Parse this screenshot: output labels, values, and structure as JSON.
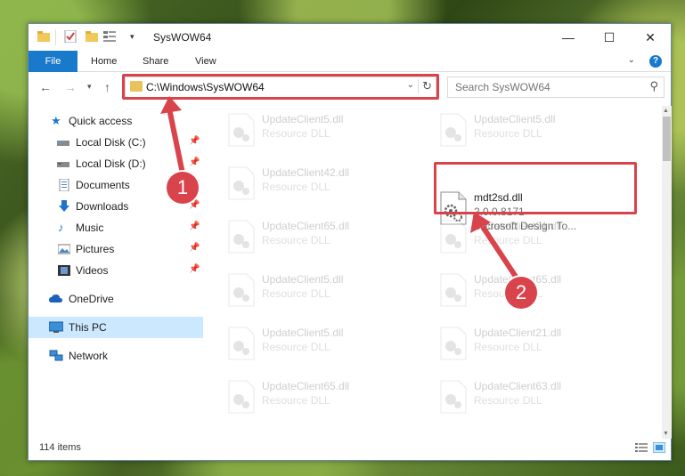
{
  "window": {
    "title": "SysWOW64"
  },
  "ribbon": {
    "file": "File",
    "home": "Home",
    "share": "Share",
    "view": "View",
    "help": "?"
  },
  "address": {
    "path": "C:\\Windows\\SysWOW64"
  },
  "search": {
    "placeholder": "Search SysWOW64"
  },
  "sidebar": {
    "items": [
      {
        "label": "Quick access",
        "icon": "star-icon"
      },
      {
        "label": "Local Disk (C:)",
        "icon": "drive-icon"
      },
      {
        "label": "Local Disk (D:)",
        "icon": "drive-icon"
      },
      {
        "label": "Documents",
        "icon": "documents-icon"
      },
      {
        "label": "Downloads",
        "icon": "download-icon"
      },
      {
        "label": "Music",
        "icon": "music-icon"
      },
      {
        "label": "Pictures",
        "icon": "pictures-icon"
      },
      {
        "label": "Videos",
        "icon": "videos-icon"
      },
      {
        "label": "OneDrive",
        "icon": "cloud-icon"
      },
      {
        "label": "This PC",
        "icon": "computer-icon"
      },
      {
        "label": "Network",
        "icon": "network-icon"
      }
    ],
    "selected": "This PC"
  },
  "files": [
    {
      "name": "UpdateClient5.dll",
      "desc": "Resource DLL"
    },
    {
      "name": "UpdateClient5.dll",
      "desc": "Resource DLL"
    },
    {
      "name": "UpdateClient42.dll",
      "desc": "Resource DLL"
    },
    {
      "name": "mdt2sd.dll",
      "version": "2.0.0.8171",
      "company": "Microsoft Design To..."
    },
    {
      "name": "UpdateClient65.dll",
      "desc": "Resource DLL"
    },
    {
      "name": "UpdateClient21.dll",
      "desc": "Resource DLL"
    },
    {
      "name": "UpdateClient5.dll",
      "desc": "Resource DLL"
    },
    {
      "name": "UpdateClient65.dll",
      "desc": "Resource DLL"
    },
    {
      "name": "UpdateClient5.dll",
      "desc": "Resource DLL"
    },
    {
      "name": "UpdateClient21.dll",
      "desc": "Resource DLL"
    },
    {
      "name": "UpdateClient65.dll",
      "desc": "Resource DLL"
    },
    {
      "name": "UpdateClient63.dll",
      "desc": "Resource DLL"
    }
  ],
  "status": {
    "count": "114 items"
  },
  "annotations": {
    "step1": "1",
    "step2": "2",
    "color": "#d9434b"
  },
  "colors": {
    "accent": "#1979ca",
    "selection": "#cce8ff"
  }
}
